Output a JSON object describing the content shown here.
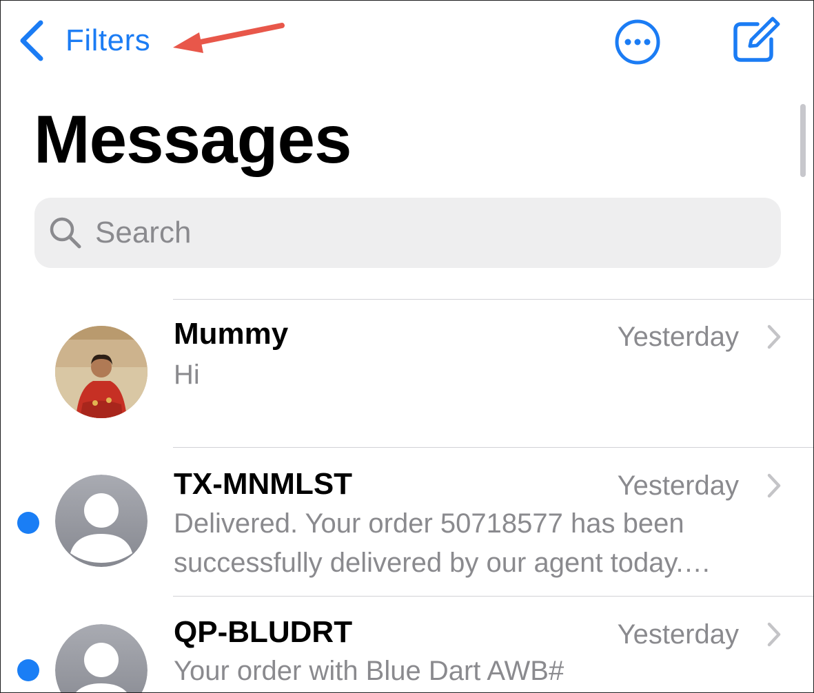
{
  "nav": {
    "back_label": "Filters"
  },
  "title": "Messages",
  "search": {
    "placeholder": "Search"
  },
  "colors": {
    "accent": "#1b7cf4",
    "unread": "#1a7ef5",
    "annotation_arrow": "#e8574a",
    "secondary_text": "#8a8a8e",
    "search_bg": "#eeeeef",
    "avatar_gray": "#a2a4ab"
  },
  "icons": {
    "back": "chevron-left-icon",
    "more": "ellipsis-circle-icon",
    "compose": "compose-icon",
    "search": "magnifying-glass-icon",
    "disclosure": "chevron-right-icon"
  },
  "conversations": [
    {
      "name": "Mummy",
      "time": "Yesterday",
      "preview": "Hi",
      "unread": false,
      "avatar": "photo"
    },
    {
      "name": "TX-MNMLST",
      "time": "Yesterday",
      "preview": "Delivered. Your order 50718577 has been successfully delivered by our agent today. Thank you for shopping with us.",
      "unread": true,
      "avatar": "generic-person-icon"
    },
    {
      "name": "QP-BLUDRT",
      "time": "Yesterday",
      "preview": "Your order with Blue Dart AWB#",
      "unread": true,
      "avatar": "generic-person-icon"
    }
  ]
}
